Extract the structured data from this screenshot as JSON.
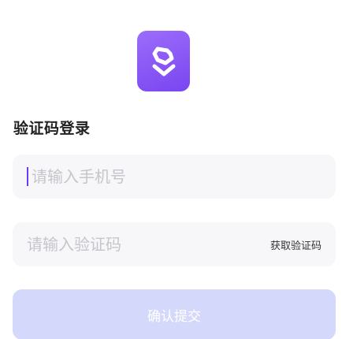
{
  "app": {
    "logo_icon": "app-logo-icon",
    "accent_color": "#7a45f0"
  },
  "page": {
    "title": "验证码登录"
  },
  "form": {
    "phone": {
      "value": "",
      "placeholder": "请输入手机号"
    },
    "code": {
      "value": "",
      "placeholder": "请输入验证码"
    },
    "get_code_label": "获取验证码",
    "submit_label": "确认提交",
    "submit_color": "#d4d9fb"
  }
}
